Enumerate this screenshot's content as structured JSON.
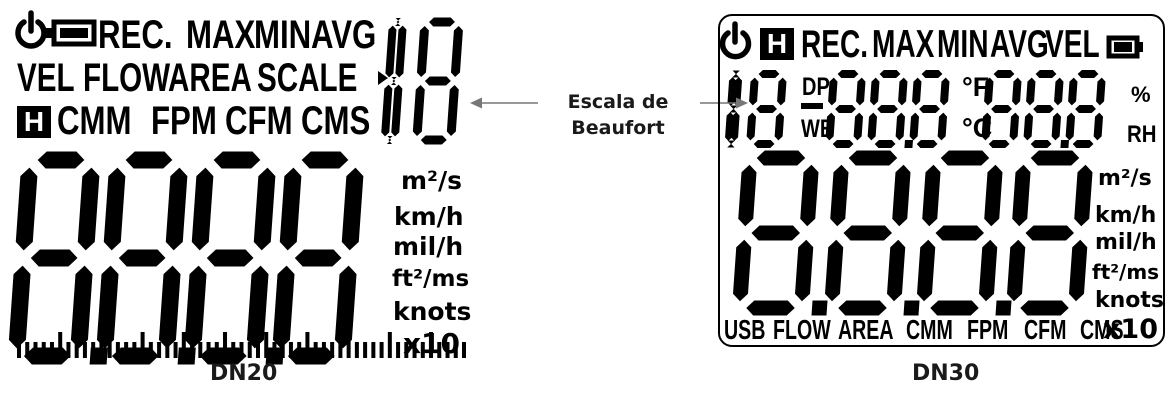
{
  "callout": {
    "label_line1": "Escala de",
    "label_line2": "Beaufort"
  },
  "dn20": {
    "caption": "DN20",
    "row1": {
      "rec": "REC.",
      "max": "MAX",
      "min": "MIN",
      "avg": "AVG"
    },
    "row2": {
      "vel": "VEL",
      "flow": "FLOW",
      "area": "AREA",
      "scale": "SCALE"
    },
    "row3": {
      "hold": "H",
      "cmm": "CMM",
      "fpm": "FPM",
      "cfm": "CFM",
      "cms": "CMS"
    },
    "units": {
      "m2s": "m²/s",
      "kmh": "km/h",
      "milh": "mil/h",
      "ft2ms": "ft²/ms",
      "knots": "knots",
      "x10": "x10"
    }
  },
  "dn30": {
    "caption": "DN30",
    "top": {
      "hold": "H",
      "rec": "REC.",
      "max": "MAX",
      "min": "MIN",
      "avg": "AVG",
      "vel": "VEL"
    },
    "mid": {
      "dp": "DP",
      "wb": "WB",
      "degf": "°F",
      "degc": "°C",
      "pct": "%",
      "rh": "RH"
    },
    "units": {
      "m2s": "m²/s",
      "kmh": "km/h",
      "milh": "mil/h",
      "ft2ms": "ft²/ms",
      "knots": "knots",
      "x10": "x10"
    },
    "bottom": {
      "usb": "USB",
      "flow": "FLOW",
      "area": "AREA",
      "cmm": "CMM",
      "fpm": "FPM",
      "cfm": "CFM",
      "cms": "CMS"
    }
  }
}
